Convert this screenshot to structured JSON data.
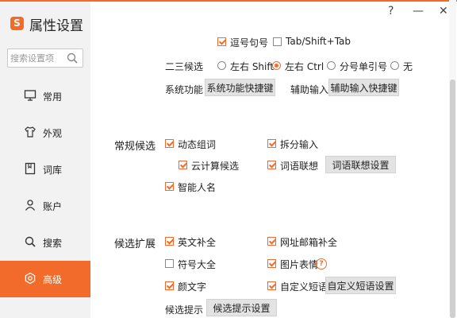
{
  "app": {
    "title": "属性设置",
    "logo_letter": "S"
  },
  "window": {
    "help": "?",
    "minimize": "—",
    "close": "✕"
  },
  "search": {
    "placeholder": "搜索设置项"
  },
  "sidebar": {
    "items": [
      {
        "label": "常用",
        "icon": "monitor-icon"
      },
      {
        "label": "外观",
        "icon": "shirt-icon"
      },
      {
        "label": "词库",
        "icon": "book-icon"
      },
      {
        "label": "账户",
        "icon": "user-icon"
      },
      {
        "label": "搜索",
        "icon": "search-icon"
      },
      {
        "label": "高级",
        "icon": "gear-icon",
        "active": true
      }
    ]
  },
  "top": {
    "comma_period": {
      "label": "逗号句号",
      "checked": true
    },
    "tab_shift": {
      "label": "Tab/Shift+Tab",
      "checked": false
    },
    "second_third": {
      "label": "二三候选",
      "options": [
        {
          "label": "左右 Shift",
          "selected": false
        },
        {
          "label": "左右 Ctrl",
          "selected": true
        },
        {
          "label": "分号单引号",
          "selected": false
        },
        {
          "label": "无",
          "selected": false
        }
      ]
    },
    "system_func": {
      "label": "系统功能",
      "button": "系统功能快捷键"
    },
    "aux_input": {
      "label": "辅助输入",
      "button": "辅助输入快捷键"
    }
  },
  "common": {
    "title": "常规候选",
    "dynamic_words": {
      "label": "动态组词",
      "checked": true
    },
    "split_input": {
      "label": "拆分输入",
      "checked": true
    },
    "cloud": {
      "label": "云计算候选",
      "checked": true
    },
    "word_assoc": {
      "label": "词语联想",
      "checked": true,
      "button": "词语联想设置"
    },
    "smart_names": {
      "label": "智能人名",
      "checked": true
    }
  },
  "expand": {
    "title": "候选扩展",
    "english": {
      "label": "英文补全",
      "checked": true
    },
    "url_email": {
      "label": "网址邮箱补全",
      "checked": true
    },
    "symbols": {
      "label": "符号大全",
      "checked": false
    },
    "picture": {
      "label": "图片表情",
      "checked": true,
      "help": "?"
    },
    "emoticon": {
      "label": "颜文字",
      "checked": true
    },
    "custom_phrase": {
      "label": "自定义短语",
      "checked": true,
      "button": "自定义短语设置"
    },
    "hint": {
      "label": "候选提示",
      "button": "候选提示设置"
    }
  },
  "colors": {
    "accent": "#f26b2a",
    "sidebar_bg": "#f2f2f2",
    "button_bg": "#e3e3e3"
  }
}
